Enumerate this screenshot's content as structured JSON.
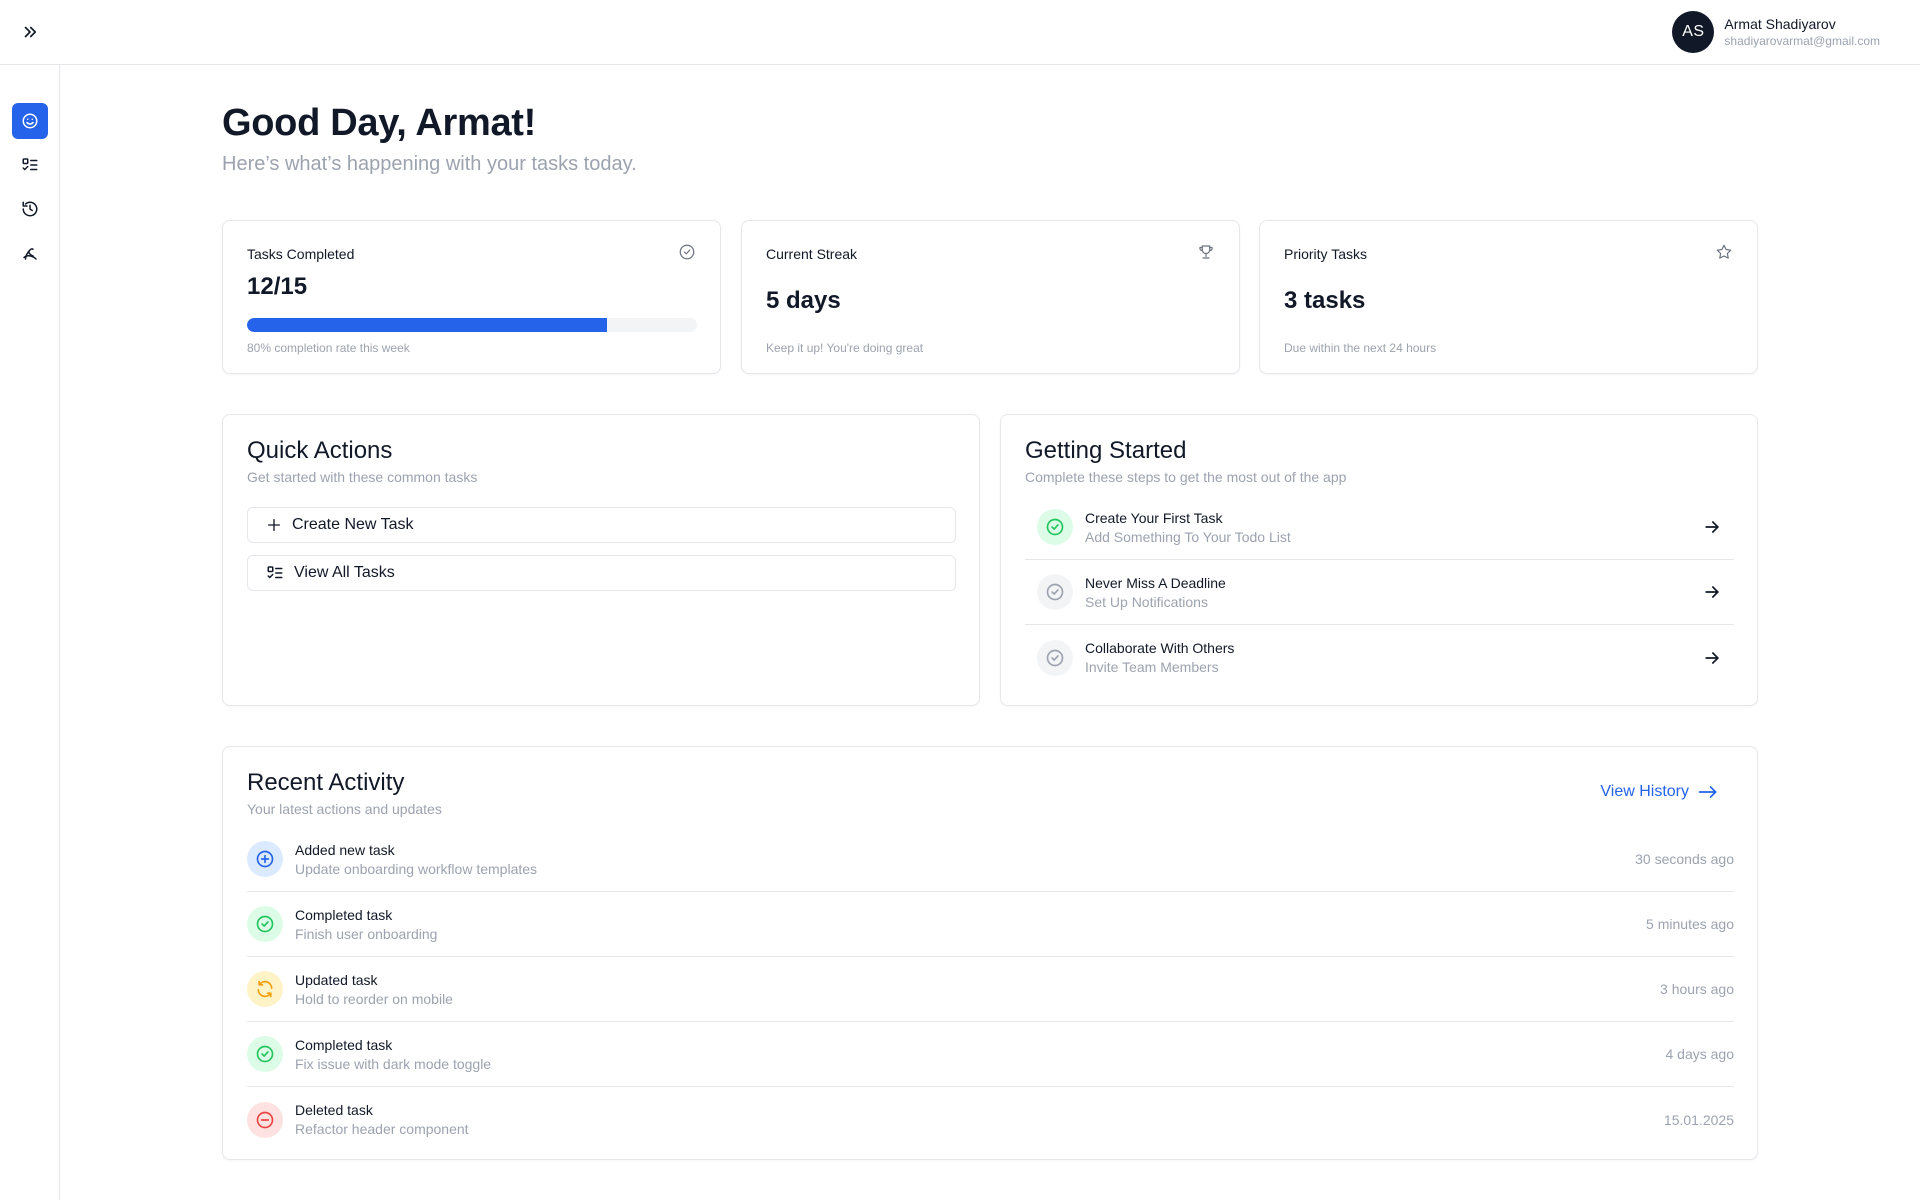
{
  "user": {
    "initials": "AS",
    "name": "Armat Shadiyarov",
    "email": "shadiyarovarmat@gmail.com"
  },
  "sidebar": {
    "items": [
      {
        "icon": "smile-icon",
        "active": true
      },
      {
        "icon": "list-check-icon",
        "active": false
      },
      {
        "icon": "history-icon",
        "active": false
      },
      {
        "icon": "cat-icon",
        "active": false
      }
    ]
  },
  "header": {
    "title": "Good Day, Armat!",
    "subtitle": "Here’s what’s happening with your tasks today."
  },
  "stats": {
    "tasks_completed": {
      "label": "Tasks Completed",
      "value": "12/15",
      "progress": 0.8,
      "note": "80% completion rate this week"
    },
    "current_streak": {
      "label": "Current Streak",
      "value": "5 days",
      "note": "Keep it up! You're doing great"
    },
    "priority_tasks": {
      "label": "Priority Tasks",
      "value": "3 tasks",
      "note": "Due within the next 24 hours"
    }
  },
  "quick_actions": {
    "title": "Quick Actions",
    "subtitle": "Get started with these common tasks",
    "buttons": [
      {
        "label": "Create New Task",
        "icon": "plus-icon"
      },
      {
        "label": "View All Tasks",
        "icon": "list-check-icon"
      }
    ]
  },
  "getting_started": {
    "title": "Getting Started",
    "subtitle": "Complete these steps to get the most out of the app",
    "steps": [
      {
        "title": "Create Your First Task",
        "subtitle": "Add Something To Your Todo List",
        "done": true
      },
      {
        "title": "Never Miss A Deadline",
        "subtitle": "Set Up Notifications",
        "done": false
      },
      {
        "title": "Collaborate With Others",
        "subtitle": "Invite Team Members",
        "done": false
      }
    ]
  },
  "recent_activity": {
    "title": "Recent Activity",
    "subtitle": "Your latest actions and updates",
    "view_history_label": "View History",
    "items": [
      {
        "title": "Added new task",
        "subtitle": "Update onboarding workflow templates",
        "time": "30 seconds ago",
        "type": "added"
      },
      {
        "title": "Completed task",
        "subtitle": "Finish user onboarding",
        "time": "5 minutes ago",
        "type": "completed"
      },
      {
        "title": "Updated task",
        "subtitle": "Hold to reorder on mobile",
        "time": "3 hours ago",
        "type": "updated"
      },
      {
        "title": "Completed task",
        "subtitle": "Fix issue with dark mode toggle",
        "time": "4 days ago",
        "type": "completed"
      },
      {
        "title": "Deleted task",
        "subtitle": "Refactor header component",
        "time": "15.01.2025",
        "type": "deleted"
      }
    ]
  },
  "colors": {
    "accent": "#2563eb",
    "success": "#22c55e",
    "warning": "#f59e0b",
    "danger": "#ef4444",
    "muted": "#9ca3af"
  }
}
